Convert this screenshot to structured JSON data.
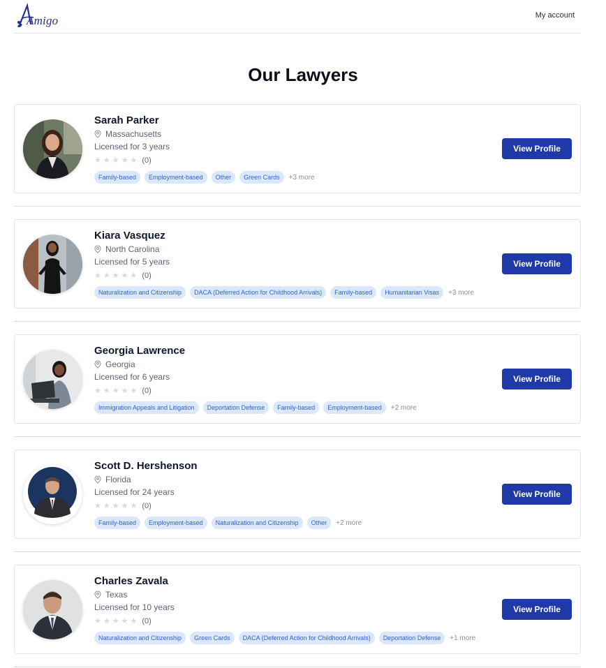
{
  "header": {
    "logo_text": "Amigo",
    "account_label": "My account"
  },
  "page": {
    "title": "Our Lawyers"
  },
  "lawyers": [
    {
      "name": "Sarah Parker",
      "location": "Massachusetts",
      "licensed": "Licensed for 3 years",
      "rating_count": "(0)",
      "tags": [
        "Family-based",
        "Employment-based",
        "Other",
        "Green Cards"
      ],
      "more": "+3 more",
      "button": "View Profile"
    },
    {
      "name": "Kiara Vasquez",
      "location": "North Carolina",
      "licensed": "Licensed for 5 years",
      "rating_count": "(0)",
      "tags": [
        "Naturalization and Citizenship",
        "DACA (Deferred Action for Childhood Arrivals)",
        "Family-based",
        "Humanitarian Visas"
      ],
      "more": "+3 more",
      "button": "View Profile"
    },
    {
      "name": "Georgia Lawrence",
      "location": "Georgia",
      "licensed": "Licensed for 6 years",
      "rating_count": "(0)",
      "tags": [
        "Immigration Appeals and Litigation",
        "Deportation Defense",
        "Family-based",
        "Employment-based"
      ],
      "more": "+2 more",
      "button": "View Profile"
    },
    {
      "name": "Scott D. Hershenson",
      "location": "Florida",
      "licensed": "Licensed for 24 years",
      "rating_count": "(0)",
      "tags": [
        "Family-based",
        "Employment-based",
        "Naturalization and Citizenship",
        "Other"
      ],
      "more": "+2 more",
      "button": "View Profile"
    },
    {
      "name": "Charles Zavala",
      "location": "Texas",
      "licensed": "Licensed for 10 years",
      "rating_count": "(0)",
      "tags": [
        "Naturalization and Citizenship",
        "Green Cards",
        "DACA (Deferred Action for Childhood Arrivals)",
        "Deportation Defense"
      ],
      "more": "+1 more",
      "button": "View Profile"
    }
  ],
  "colors": {
    "brand": "#23308d",
    "button": "#1f3aa8",
    "tag_bg": "#dbe8fb",
    "tag_text": "#3562c1"
  }
}
